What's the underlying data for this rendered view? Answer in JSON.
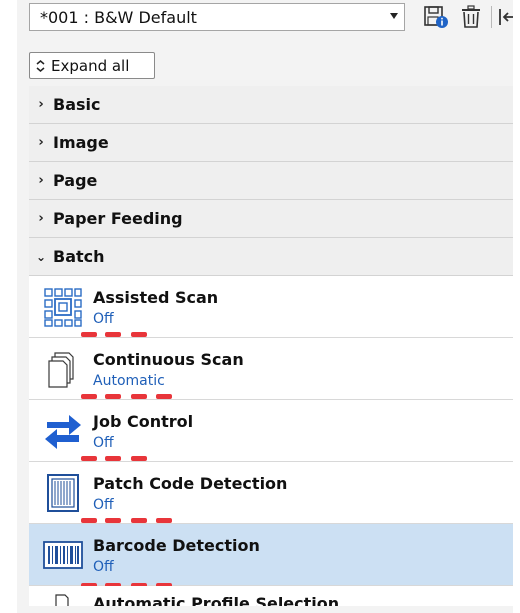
{
  "toolbar": {
    "profile_value": "*001 : B&W Default",
    "save_icon": "save-info-icon",
    "delete_icon": "trash-icon",
    "import_icon": "import-icon"
  },
  "expand_all_label": "Expand all",
  "categories": [
    {
      "label": "Basic",
      "expanded": false
    },
    {
      "label": "Image",
      "expanded": false
    },
    {
      "label": "Page",
      "expanded": false
    },
    {
      "label": "Paper Feeding",
      "expanded": false
    },
    {
      "label": "Batch",
      "expanded": true
    }
  ],
  "batch_items": [
    {
      "title": "Assisted Scan",
      "value": "Off",
      "icon": "assisted-scan-icon"
    },
    {
      "title": "Continuous Scan",
      "value": "Automatic",
      "icon": "continuous-scan-icon"
    },
    {
      "title": "Job Control",
      "value": "Off",
      "icon": "job-control-icon"
    },
    {
      "title": "Patch Code Detection",
      "value": "Off",
      "icon": "patch-code-icon"
    },
    {
      "title": "Barcode Detection",
      "value": "Off",
      "icon": "barcode-icon",
      "selected": true
    },
    {
      "title": "Automatic Profile Selection",
      "icon": "profile-selection-icon"
    }
  ],
  "colors": {
    "accent_blue": "#1f5fb8",
    "selected_bg": "#cce0f3",
    "annotation_red": "#e8353a"
  }
}
